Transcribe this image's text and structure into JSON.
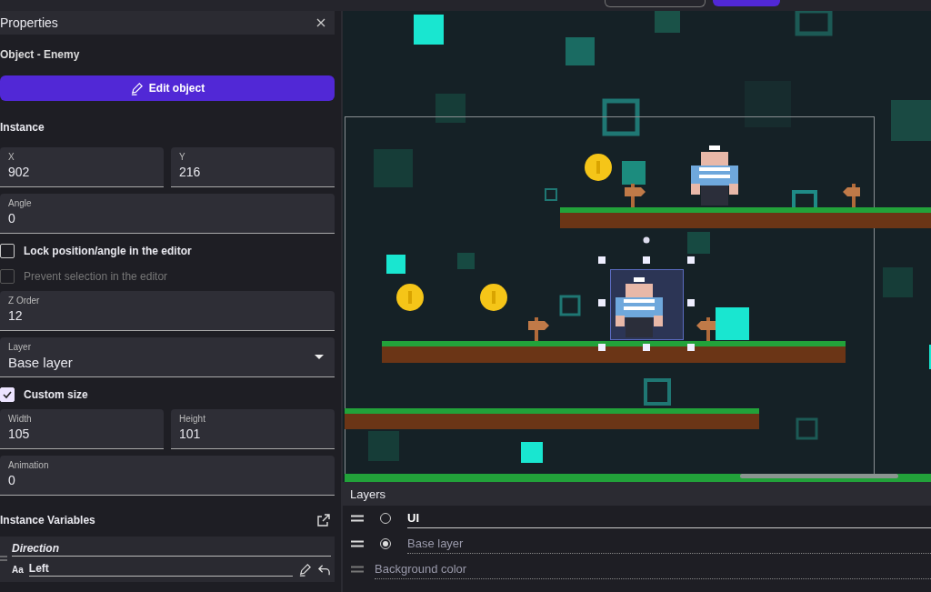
{
  "properties": {
    "title": "Properties",
    "object_label": "Object  - Enemy",
    "edit_button": "Edit object",
    "section": "Instance",
    "rows": [
      {
        "kind": "fields",
        "fields": [
          {
            "label": "X",
            "value": "902"
          },
          {
            "label": "Y",
            "value": "216"
          }
        ]
      },
      {
        "kind": "fields",
        "fields": [
          {
            "label": "Angle",
            "value": "0"
          }
        ]
      },
      {
        "kind": "checkbox",
        "label": "Lock position/angle in the editor",
        "checked": false,
        "disabled": false
      },
      {
        "kind": "checkbox",
        "label": "Prevent selection in the editor",
        "checked": false,
        "disabled": true
      },
      {
        "kind": "fields",
        "fields": [
          {
            "label": "Z Order",
            "value": "12"
          }
        ]
      },
      {
        "kind": "select",
        "label": "Layer",
        "value": "Base layer"
      },
      {
        "kind": "checkbox",
        "label": "Custom size",
        "checked": true,
        "disabled": false
      },
      {
        "kind": "fields",
        "fields": [
          {
            "label": "Width",
            "value": "105"
          },
          {
            "label": "Height",
            "value": "101"
          }
        ]
      },
      {
        "kind": "fields",
        "fields": [
          {
            "label": "Animation",
            "value": "0"
          }
        ]
      }
    ],
    "variables_title": "Instance Variables",
    "variables": [
      {
        "name": "Direction",
        "type": "Aa",
        "value": "Left"
      }
    ]
  },
  "layers": {
    "title": "Layers",
    "items": [
      {
        "name": "UI",
        "selected": false,
        "editing": true
      },
      {
        "name": "Base layer",
        "selected": true,
        "editing": false
      }
    ],
    "background": "Background color"
  }
}
